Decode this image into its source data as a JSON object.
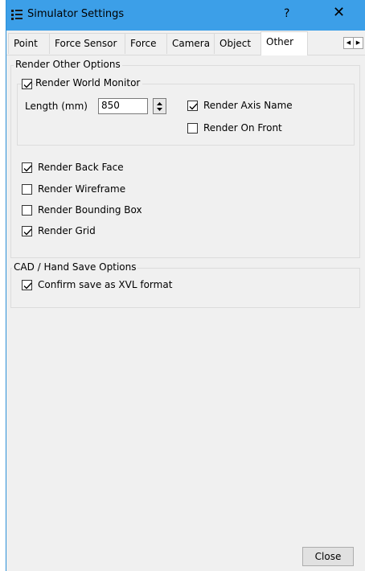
{
  "window": {
    "title": "Simulator Settings",
    "help": "?",
    "close": "✕"
  },
  "tabs": [
    {
      "label": "Point"
    },
    {
      "label": "Force Sensor"
    },
    {
      "label": "Force"
    },
    {
      "label": "Camera"
    },
    {
      "label": "Object"
    },
    {
      "label": "Other"
    }
  ],
  "active_tab": "Other",
  "render_other": {
    "title": "Render Other Options",
    "world_monitor": {
      "label": "Render World Monitor",
      "checked": true,
      "length_label": "Length (mm)",
      "length_value": "850",
      "axis_name": {
        "label": "Render Axis Name",
        "checked": true
      },
      "on_front": {
        "label": "Render On Front",
        "checked": false
      }
    },
    "back_face": {
      "label": "Render Back Face",
      "checked": true
    },
    "wireframe": {
      "label": "Render Wireframe",
      "checked": false
    },
    "bounding_box": {
      "label": "Render Bounding Box",
      "checked": false
    },
    "grid": {
      "label": "Render Grid",
      "checked": true
    }
  },
  "cad_save": {
    "title": "CAD / Hand Save Options",
    "confirm_xvl": {
      "label": "Confirm save as XVL format",
      "checked": true
    }
  },
  "footer": {
    "close_label": "Close"
  },
  "colors": {
    "titlebar": "#3c9fe8",
    "panel": "#f0f0f0"
  }
}
